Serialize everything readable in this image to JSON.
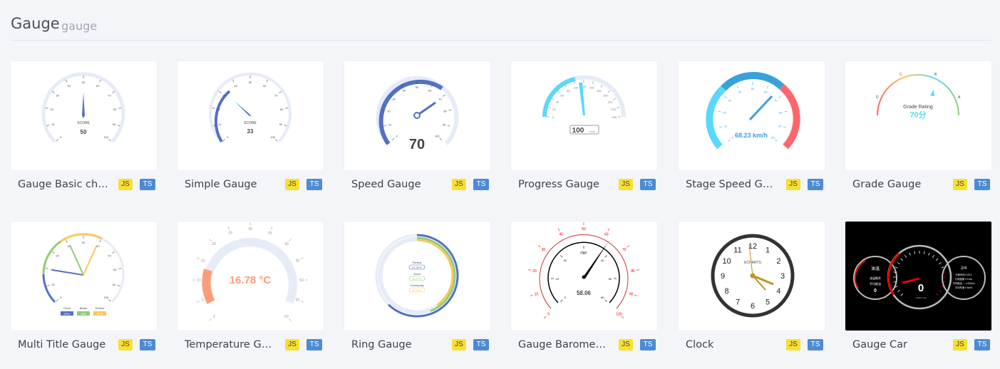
{
  "section": {
    "title": "Gauge",
    "subtitle": "gauge"
  },
  "badges": {
    "js": "JS",
    "ts": "TS"
  },
  "colors": {
    "accent_blue": "#5470c6",
    "green": "#91cc75",
    "yellow": "#fac858",
    "red": "#fd666d",
    "cyan": "#58d9f9"
  },
  "cards": [
    {
      "title": "Gauge Basic chart",
      "label": "SCORE",
      "value": "50",
      "ticks": [
        "0",
        "10",
        "20",
        "30",
        "40",
        "50",
        "60",
        "70",
        "80",
        "90",
        "100"
      ]
    },
    {
      "title": "Simple Gauge",
      "label": "SCORE",
      "value": "33",
      "ticks": [
        "0",
        "10",
        "20",
        "30",
        "40",
        "50",
        "60",
        "70",
        "80",
        "90",
        "100"
      ]
    },
    {
      "title": "Speed Gauge",
      "value": "70",
      "ticks": [
        "0",
        "10",
        "20",
        "30",
        "40",
        "50",
        "60",
        "70",
        "80",
        "90",
        "100"
      ]
    },
    {
      "title": "Progress Gauge",
      "value": "100",
      "unit": "km/h",
      "ticks": [
        "0",
        "20",
        "40",
        "60",
        "80",
        "100",
        "120",
        "140",
        "160",
        "180",
        "200",
        "220",
        "240"
      ]
    },
    {
      "title": "Stage Speed Gauge",
      "value": "68.23 km/h",
      "ticks": [
        "0",
        "10",
        "20",
        "30",
        "40",
        "50",
        "60",
        "70",
        "80",
        "90",
        "100"
      ]
    },
    {
      "title": "Grade Gauge",
      "label": "Grade Rating",
      "value": "70分",
      "grades": [
        "D",
        "C",
        "B",
        "A"
      ]
    },
    {
      "title": "Multi Title Gauge",
      "legend": [
        {
          "name": "Good",
          "value": "20%"
        },
        {
          "name": "Better",
          "value": "40%"
        },
        {
          "name": "Perfect",
          "value": "60%"
        }
      ],
      "ticks": [
        "0",
        "10",
        "20",
        "30",
        "40",
        "50",
        "60",
        "70",
        "80",
        "90",
        "100"
      ]
    },
    {
      "title": "Temperature Gauge Chart",
      "value": "16.78 °C",
      "ticks": [
        "0",
        "5",
        "10",
        "15",
        "20",
        "25",
        "30",
        "35",
        "40",
        "45",
        "50",
        "55",
        "60"
      ]
    },
    {
      "title": "Ring Gauge",
      "rows": [
        {
          "name": "Perfect",
          "value": "62.39%"
        },
        {
          "name": "Good",
          "value": "44.07%"
        },
        {
          "name": "Commonly",
          "value": "40.49%"
        }
      ]
    },
    {
      "title": "Gauge Barometer chart",
      "label": "PLP",
      "value": "58.06",
      "inner_ticks": [
        "0",
        "10",
        "20",
        "30",
        "40",
        "50",
        "60"
      ],
      "outer_ticks": [
        "0",
        "10",
        "20",
        "30",
        "40",
        "50",
        "60",
        "70",
        "80",
        "90",
        "100"
      ]
    },
    {
      "title": "Clock",
      "label": "ECHARTS",
      "ticks": [
        "12",
        "1",
        "2",
        "3",
        "4",
        "5",
        "6",
        "7",
        "8",
        "9",
        "10",
        "11"
      ]
    },
    {
      "title": "Gauge Car",
      "left": {
        "label": "油温",
        "value": "0"
      },
      "center": {
        "value": "0",
        "unit": "x1000 r/min"
      },
      "right": {
        "value": "2/4",
        "lines": [
          "行驶时间 0:00:1",
          "行驶距离 0.0 km",
          "平均耗油 --- L/100km",
          "平均车速 0 km/h"
        ]
      },
      "left_lines": [
        "油温剩余",
        "平均耗油"
      ]
    }
  ]
}
